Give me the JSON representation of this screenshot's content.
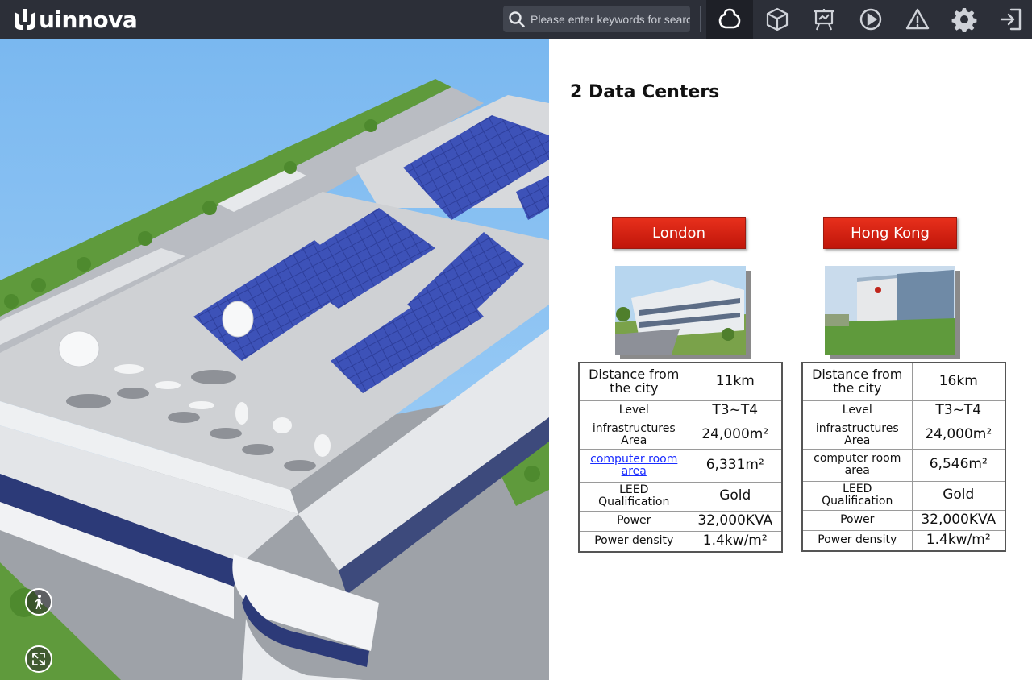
{
  "app": {
    "logo_text": "uinnova"
  },
  "search": {
    "placeholder": "Please enter keywords for search",
    "icon": "search-icon"
  },
  "toolbar": {
    "tools": [
      {
        "name": "network-icon",
        "active": true
      },
      {
        "name": "cube-icon",
        "active": false
      },
      {
        "name": "presentation-icon",
        "active": false
      },
      {
        "name": "play-icon",
        "active": false
      },
      {
        "name": "warning-icon",
        "active": false
      },
      {
        "name": "gear-icon",
        "active": false
      },
      {
        "name": "logout-icon",
        "active": false
      }
    ]
  },
  "scene": {
    "controls": [
      "walk-mode-icon",
      "fullscreen-icon"
    ]
  },
  "panel": {
    "title": "2 Data Centers",
    "centers": [
      {
        "city": "London",
        "rows": [
          {
            "label": "Distance from the city",
            "value": "11km"
          },
          {
            "label": "Level",
            "value": "T3~T4"
          },
          {
            "label": "infrastructures Area",
            "value": "24,000m²"
          },
          {
            "label": "computer room area",
            "value": "6,331m²"
          },
          {
            "label": "LEED Qualification",
            "value": "Gold"
          },
          {
            "label": "Power",
            "value": "32,000KVA"
          },
          {
            "label": "Power density",
            "value": "1.4kw/m²"
          }
        ]
      },
      {
        "city": "Hong Kong",
        "rows": [
          {
            "label": "Distance from the city",
            "value": "16km"
          },
          {
            "label": "Level",
            "value": "T3~T4"
          },
          {
            "label": "infrastructures Area",
            "value": "24,000m²"
          },
          {
            "label": "computer room area",
            "value": "6,546m²"
          },
          {
            "label": "LEED Qualification",
            "value": "Gold"
          },
          {
            "label": "Power",
            "value": "32,000KVA"
          },
          {
            "label": "Power density",
            "value": "1.4kw/m²"
          }
        ]
      }
    ]
  },
  "colors": {
    "topbar": "#2c2f38",
    "city_button": "#d9200f",
    "link": "#1a2cff"
  }
}
